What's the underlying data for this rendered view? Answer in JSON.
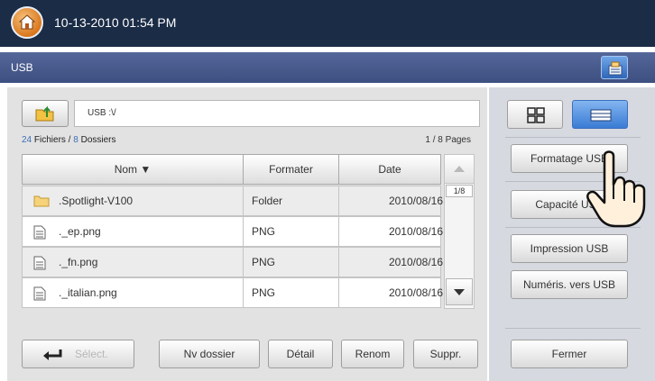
{
  "header": {
    "datetime": "10-13-2010 01:54 PM",
    "home_icon": "home-icon",
    "title": "USB",
    "jobs_icon": "job-status-icon"
  },
  "browser": {
    "path": "USB :\\/",
    "summary": {
      "file_count": "24",
      "file_label": " Fichiers / ",
      "folder_count": "8",
      "folder_label": " Dossiers"
    },
    "pages": "1 / 8  Pages",
    "columns": {
      "name": "Nom ▼",
      "format": "Formater",
      "date": "Date"
    },
    "rows": [
      {
        "name": ".Spotlight-V100",
        "format": "Folder",
        "date": "2010/08/16",
        "icon": "folder-icon"
      },
      {
        "name": "._ep.png",
        "format": "PNG",
        "date": "2010/08/16",
        "icon": "file-icon"
      },
      {
        "name": "._fn.png",
        "format": "PNG",
        "date": "2010/08/16",
        "icon": "file-icon"
      },
      {
        "name": "._italian.png",
        "format": "PNG",
        "date": "2010/08/16",
        "icon": "file-icon"
      }
    ],
    "scroll_page": "1/8"
  },
  "toolbar": {
    "select": "Sélect.",
    "new_folder": "Nv dossier",
    "detail": "Détail",
    "rename": "Renom",
    "delete": "Suppr."
  },
  "side": {
    "format_usb": "Formatage USB",
    "capacity_usb": "Capacité USB",
    "print_usb": "Impression USB",
    "scan_to_usb": "Numéris. vers USB",
    "close": "Fermer"
  },
  "colors": {
    "topbar": "#1b2c47",
    "titlebar": "#44558a",
    "accent_blue": "#3a7bd4",
    "count_blue": "#3c6fb7"
  }
}
